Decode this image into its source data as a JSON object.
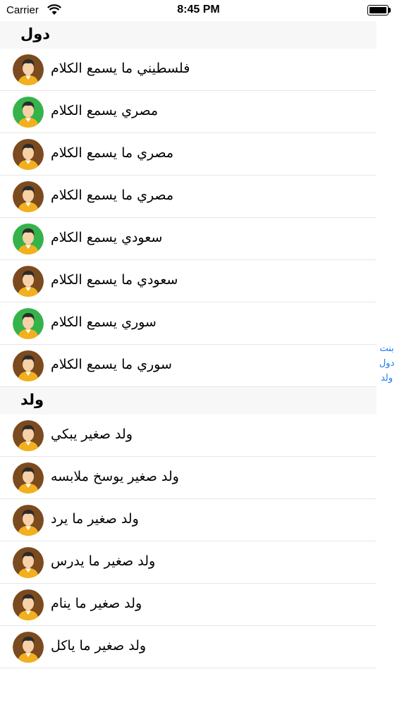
{
  "status_bar": {
    "carrier": "Carrier",
    "time": "8:45 PM"
  },
  "sections": [
    {
      "header": "دول",
      "rows": [
        {
          "text": "فلسطيني  ما يسمع الكلام",
          "avatar": "brown"
        },
        {
          "text": "مصري يسمع الكلام",
          "avatar": "green"
        },
        {
          "text": "مصري  ما يسمع الكلام",
          "avatar": "brown"
        },
        {
          "text": "مصري  ما يسمع الكلام",
          "avatar": "brown"
        },
        {
          "text": "سعودي يسمع الكلام",
          "avatar": "green"
        },
        {
          "text": "سعودي  ما يسمع الكلام",
          "avatar": "brown"
        },
        {
          "text": "سوري يسمع الكلام",
          "avatar": "green"
        },
        {
          "text": "سوري  ما يسمع الكلام",
          "avatar": "brown"
        }
      ]
    },
    {
      "header": "ولد",
      "rows": [
        {
          "text": "ولد صغير يبكي",
          "avatar": "brown"
        },
        {
          "text": "ولد صغير يوسخ ملابسه",
          "avatar": "brown"
        },
        {
          "text": "ولد صغير ما يرد",
          "avatar": "brown"
        },
        {
          "text": "ولد صغير ما يدرس",
          "avatar": "brown"
        },
        {
          "text": "ولد صغير ما ينام",
          "avatar": "brown"
        },
        {
          "text": "ولد صغير ما ياكل",
          "avatar": "brown"
        }
      ]
    }
  ],
  "index": [
    "بنت",
    "دول",
    "ولد"
  ],
  "colors": {
    "avatar_brown": "#7b4a1e",
    "avatar_green": "#35b34a",
    "index_blue": "#1a7cf5"
  }
}
